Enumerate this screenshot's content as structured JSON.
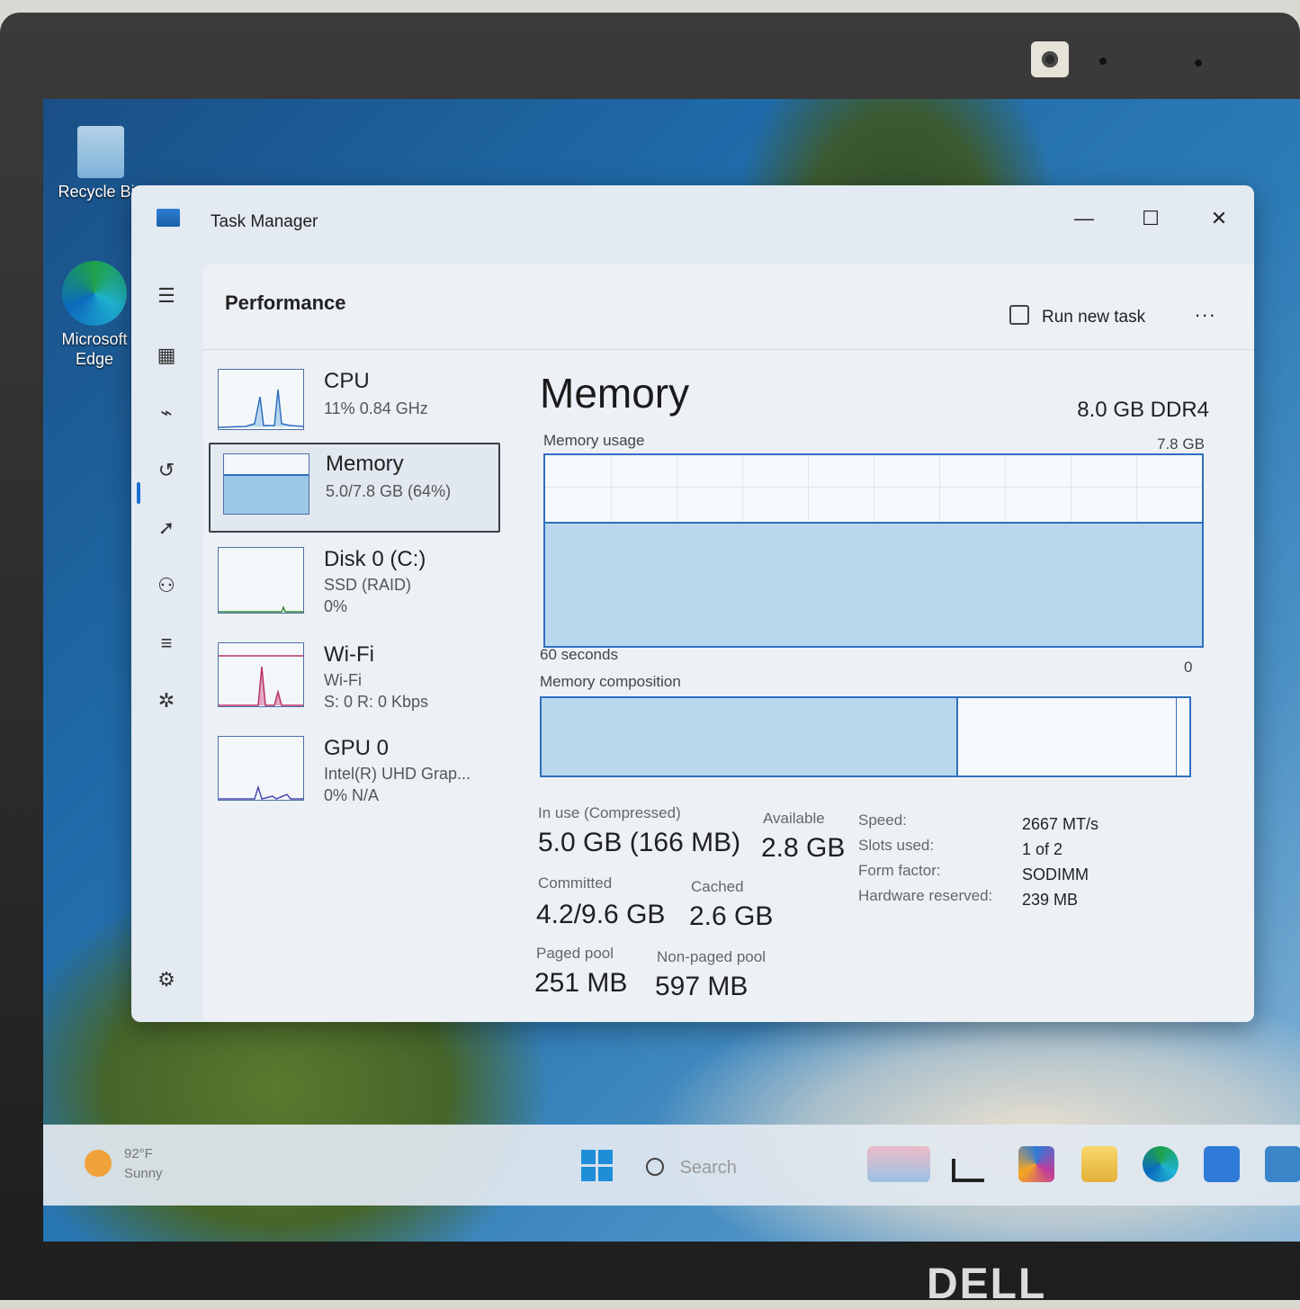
{
  "desktop": {
    "icons": [
      {
        "label": "Recycle Bin"
      },
      {
        "label": "Microsoft Edge"
      }
    ]
  },
  "taskbar": {
    "weather_temp": "92°F",
    "weather_desc": "Sunny",
    "search_placeholder": "Search"
  },
  "window": {
    "title": "Task Manager",
    "page_title": "Performance",
    "run_new_task": "Run new task",
    "more": "..."
  },
  "sidebar_items": [
    {
      "name": "CPU",
      "line1": "11%  0.84 GHz",
      "line2": ""
    },
    {
      "name": "Memory",
      "line1": "5.0/7.8 GB (64%)",
      "line2": ""
    },
    {
      "name": "Disk 0 (C:)",
      "line1": "SSD (RAID)",
      "line2": "0%"
    },
    {
      "name": "Wi-Fi",
      "line1": "Wi-Fi",
      "line2": "S: 0  R: 0 Kbps"
    },
    {
      "name": "GPU 0",
      "line1": "Intel(R) UHD Grap...",
      "line2": "0% N/A"
    }
  ],
  "memory": {
    "title": "Memory",
    "spec": "8.0 GB DDR4",
    "usage_label": "Memory usage",
    "usage_max": "7.8 GB",
    "time_label": "60 seconds",
    "min_label": "0",
    "usage_fraction": 0.64,
    "composition_label": "Memory composition",
    "composition_in_use_fraction": 0.64,
    "stats": {
      "in_use_label": "In use (Compressed)",
      "in_use_value": "5.0 GB (166 MB)",
      "available_label": "Available",
      "available_value": "2.8 GB",
      "committed_label": "Committed",
      "committed_value": "4.2/9.6 GB",
      "cached_label": "Cached",
      "cached_value": "2.6 GB",
      "paged_label": "Paged pool",
      "paged_value": "251 MB",
      "nonpaged_label": "Non-paged pool",
      "nonpaged_value": "597 MB"
    },
    "details": [
      {
        "label": "Speed:",
        "value": "2667 MT/s"
      },
      {
        "label": "Slots used:",
        "value": "1 of 2"
      },
      {
        "label": "Form factor:",
        "value": "SODIMM"
      },
      {
        "label": "Hardware reserved:",
        "value": "239 MB"
      }
    ]
  },
  "brand": "DELL"
}
